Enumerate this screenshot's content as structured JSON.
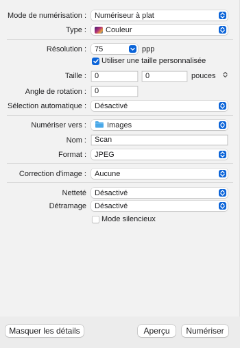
{
  "scan_mode": {
    "label": "Mode de numérisation :",
    "value": "Numériseur à plat"
  },
  "type": {
    "label": "Type :",
    "value": "Couleur",
    "icon": "color-photo-icon"
  },
  "resolution": {
    "label": "Résolution :",
    "value": "75",
    "unit": "ppp"
  },
  "custom_size": {
    "label": "Utiliser une taille personnalisée",
    "checked": true
  },
  "size": {
    "label": "Taille :",
    "width": "0",
    "height": "0",
    "unit": "pouces"
  },
  "rotation": {
    "label": "Angle de rotation :",
    "value": "0"
  },
  "auto_select": {
    "label": "Sélection automatique :",
    "value": "Désactivé"
  },
  "scan_to": {
    "label": "Numériser vers :",
    "value": "Images",
    "icon": "folder-icon"
  },
  "name": {
    "label": "Nom :",
    "value": "Scan"
  },
  "format": {
    "label": "Format :",
    "value": "JPEG"
  },
  "image_correction": {
    "label": "Correction d'image :",
    "value": "Aucune"
  },
  "sharpness": {
    "label": "Netteté",
    "value": "Désactivé"
  },
  "descreen": {
    "label": "Détramage",
    "value": "Désactivé"
  },
  "silent_mode": {
    "label": "Mode silencieux",
    "checked": false
  },
  "buttons": {
    "hide_details": "Masquer les détails",
    "preview": "Aperçu",
    "scan": "Numériser"
  },
  "colors": {
    "accent": "#0a63d8",
    "folder": "#4aa8e8"
  }
}
